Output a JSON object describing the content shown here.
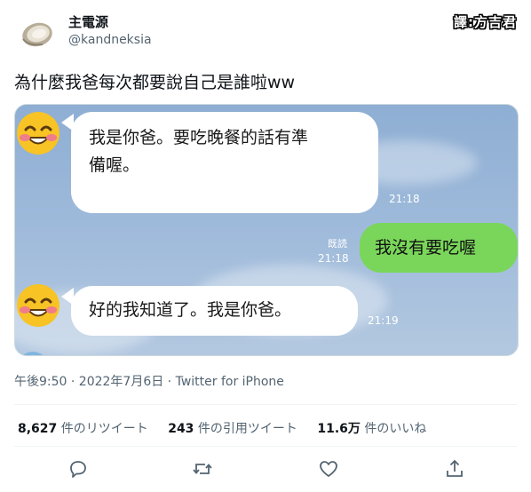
{
  "tweet": {
    "display_name": "主電源",
    "handle": "@kandneksia",
    "translator_badge": "譯:方吉君",
    "text": "為什麼我爸每次都要說自己是誰啦ww",
    "meta_line": "午後9:50 · 2022年7月6日 · Twitter for iPhone"
  },
  "chat": {
    "messages": [
      {
        "side": "left",
        "text_line1": "我是你爸。要吃晚餐的話有準",
        "text_line2": "備喔。",
        "time": "21:18"
      },
      {
        "side": "right",
        "text": "我沒有要吃喔",
        "read_label": "既読",
        "time": "21:18"
      },
      {
        "side": "left",
        "text": "好的我知道了。我是你爸。",
        "time": "21:19"
      }
    ]
  },
  "stats": {
    "retweets_count": "8,627",
    "retweets_label": "件のリツイート",
    "quotes_count": "243",
    "quotes_label": "件の引用ツイート",
    "likes_count": "11.6万",
    "likes_label": "件のいいね"
  },
  "icons": {
    "avatar": "oyster-avatar-icon",
    "reply": "reply-icon",
    "retweet": "retweet-icon",
    "like": "heart-icon",
    "share": "share-icon"
  },
  "colors": {
    "line_green": "#7ad65a",
    "chat_bg": "#9db9da",
    "twitter_gray": "#536471"
  }
}
